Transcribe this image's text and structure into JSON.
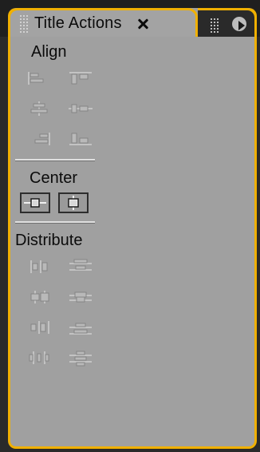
{
  "panel": {
    "tab_title": "Title Actions"
  },
  "sections": {
    "align": {
      "title": "Align"
    },
    "center": {
      "title": "Center"
    },
    "distribute": {
      "title": "Distribute"
    }
  },
  "colors": {
    "accent_outline": "#f0b000",
    "panel_bg": "#a0a0a0"
  },
  "icons": {
    "align": [
      "align-left-icon",
      "align-top-icon",
      "align-horizontal-center-icon",
      "align-vertical-center-icon",
      "align-right-icon",
      "align-bottom-icon"
    ],
    "center": [
      "center-horizontal-icon",
      "center-vertical-icon"
    ],
    "distribute": [
      "distribute-left-icon",
      "distribute-top-icon",
      "distribute-horizontal-centers-icon",
      "distribute-vertical-centers-icon",
      "distribute-right-icon",
      "distribute-bottom-icon",
      "distribute-horizontal-space-icon",
      "distribute-vertical-space-icon"
    ]
  }
}
